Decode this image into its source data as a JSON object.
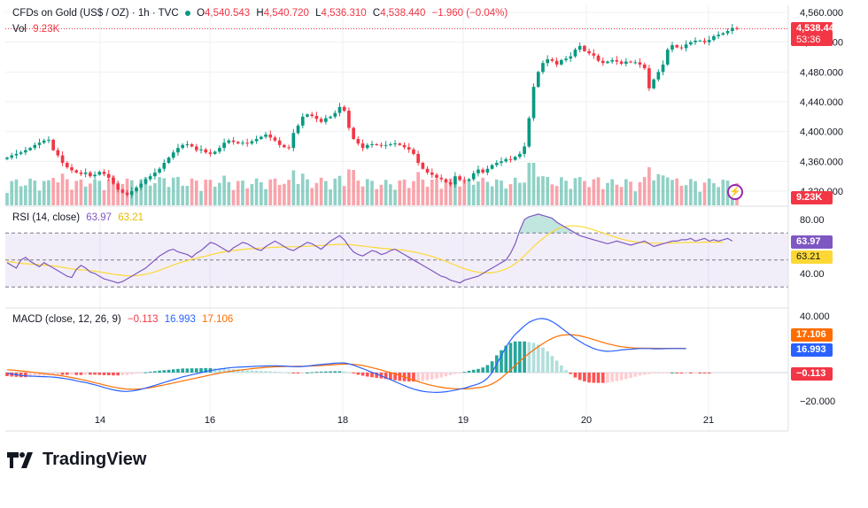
{
  "header": {
    "symbol": "CFDs on Gold (US$ / OZ) · 1h · TVC",
    "open_label": "O",
    "open": "4,540.543",
    "high_label": "H",
    "high": "4,540.720",
    "low_label": "L",
    "low": "4,536.310",
    "close_label": "C",
    "close": "4,538.440",
    "change": "−1.960 (−0.04%)",
    "vol_label": "Vol",
    "vol": "9.23K"
  },
  "price_tag": {
    "value": "4,538.440",
    "countdown": "53:36"
  },
  "vol_tag": "9.23K",
  "rsi_label": {
    "name": "RSI (14, close)",
    "value": "63.97",
    "ma": "63.21"
  },
  "rsi_tags": {
    "value": "63.97",
    "ma": "63.21"
  },
  "macd_label": {
    "name": "MACD (close, 12, 26, 9)",
    "hist": "−0.113",
    "macd": "16.993",
    "signal": "17.106"
  },
  "macd_tags": {
    "signal": "17.106",
    "macd": "16.993",
    "hist": "−0.113"
  },
  "logo_text": "TradingView",
  "colors": {
    "up": "#089981",
    "down": "#f23645",
    "rsi": "#7e57c2",
    "rsi_ma": "#fdd835",
    "macd": "#2962ff",
    "signal": "#ff6d00"
  },
  "chart_data": [
    {
      "type": "candlestick",
      "title": "CFDs on Gold (US$ / OZ)",
      "ylim": [
        4300,
        4560
      ],
      "y_ticks": [
        "4,560.000",
        "4,520.000",
        "4,480.000",
        "4,440.000",
        "4,400.000",
        "4,360.000",
        "4,320.000"
      ],
      "x_ticks": [
        "14",
        "16",
        "18",
        "19",
        "20",
        "21"
      ],
      "close_series": [
        4365,
        4368,
        4370,
        4372,
        4375,
        4378,
        4382,
        4385,
        4388,
        4389,
        4375,
        4368,
        4358,
        4352,
        4348,
        4345,
        4343,
        4345,
        4340,
        4342,
        4346,
        4343,
        4338,
        4330,
        4322,
        4318,
        4315,
        4320,
        4325,
        4330,
        4336,
        4340,
        4345,
        4350,
        4358,
        4365,
        4372,
        4378,
        4382,
        4383,
        4380,
        4375,
        4376,
        4372,
        4370,
        4373,
        4378,
        4385,
        4388,
        4386,
        4384,
        4385,
        4384,
        4387,
        4390,
        4393,
        4396,
        4392,
        4388,
        4382,
        4379,
        4378,
        4398,
        4408,
        4420,
        4423,
        4421,
        4417,
        4413,
        4418,
        4420,
        4425,
        4433,
        4428,
        4405,
        4390,
        4384,
        4378,
        4382,
        4383,
        4382,
        4381,
        4382,
        4383,
        4384,
        4382,
        4379,
        4376,
        4370,
        4358,
        4350,
        4345,
        4342,
        4338,
        4336,
        4332,
        4329,
        4340,
        4335,
        4334,
        4336,
        4344,
        4349,
        4345,
        4350,
        4355,
        4358,
        4360,
        4363,
        4362,
        4366,
        4370,
        4380,
        4418,
        4460,
        4480,
        4492,
        4497,
        4495,
        4490,
        4496,
        4498,
        4501,
        4510,
        4515,
        4508,
        4505,
        4502,
        4495,
        4492,
        4494,
        4496,
        4494,
        4491,
        4494,
        4493,
        4493,
        4490,
        4485,
        4458,
        4470,
        4480,
        4490,
        4510,
        4516,
        4513,
        4512,
        4517,
        4520,
        4522,
        4522,
        4520,
        4523,
        4528,
        4530,
        4532,
        4535,
        4539,
        4538
      ],
      "volume_title": "Vol",
      "volume_last": "9.23K"
    },
    {
      "type": "line",
      "title": "RSI (14, close)",
      "ylim": [
        20,
        100
      ],
      "y_ticks": [
        "80.00",
        "40.00"
      ],
      "bands": [
        70,
        50,
        30
      ],
      "series": [
        {
          "name": "RSI",
          "values": [
            48,
            46,
            44,
            50,
            52,
            49,
            47,
            45,
            48,
            46,
            44,
            42,
            40,
            38,
            37,
            43,
            46,
            44,
            41,
            40,
            38,
            36,
            35,
            34,
            33,
            34,
            36,
            38,
            40,
            42,
            44,
            47,
            50,
            53,
            55,
            57,
            58,
            56,
            55,
            54,
            52,
            55,
            57,
            60,
            63,
            62,
            60,
            58,
            56,
            59,
            61,
            63,
            62,
            60,
            58,
            57,
            60,
            62,
            64,
            62,
            60,
            58,
            57,
            59,
            61,
            63,
            62,
            60,
            58,
            61,
            64,
            66,
            68,
            65,
            60,
            56,
            54,
            53,
            55,
            57,
            56,
            54,
            55,
            57,
            58,
            56,
            54,
            52,
            50,
            48,
            46,
            44,
            42,
            40,
            38,
            37,
            35,
            34,
            33,
            35,
            36,
            37,
            38,
            40,
            42,
            44,
            46,
            48,
            50,
            55,
            62,
            72,
            80,
            82,
            83,
            84,
            83,
            82,
            81,
            78,
            76,
            74,
            72,
            70,
            68,
            67,
            66,
            65,
            64,
            63,
            62,
            63,
            64,
            63,
            62,
            61,
            62,
            63,
            64,
            62,
            60,
            61,
            62,
            63,
            64,
            64,
            65,
            65,
            66,
            64,
            65,
            66,
            64,
            65,
            64,
            65,
            66,
            64
          ]
        },
        {
          "name": "RSI-MA",
          "values": [
            49,
            48.5,
            48,
            47.5,
            47.2,
            47,
            46.8,
            46.5,
            46.2,
            46,
            45.6,
            45.2,
            44.6,
            44,
            43.4,
            43,
            42.7,
            42.4,
            42.1,
            41.7,
            41.2,
            40.6,
            40,
            39.5,
            39,
            38.6,
            38.3,
            38.2,
            38.4,
            38.8,
            39.4,
            40.2,
            41.2,
            42.4,
            43.7,
            45,
            46.3,
            47.5,
            48.6,
            49.6,
            50.5,
            51.3,
            52.1,
            52.9,
            53.8,
            54.6,
            55.4,
            56,
            56.5,
            57,
            57.4,
            57.8,
            58.1,
            58.4,
            58.6,
            58.8,
            59,
            59.2,
            59.4,
            59.6,
            59.7,
            59.8,
            59.8,
            59.9,
            60,
            60.2,
            60.4,
            60.6,
            60.8,
            61,
            61.2,
            61.4,
            61.6,
            61.6,
            61.4,
            61.1,
            60.7,
            60.3,
            59.9,
            59.5,
            59.1,
            58.7,
            58.4,
            58.1,
            57.8,
            57.5,
            57.1,
            56.6,
            56,
            55.3,
            54.5,
            53.6,
            52.6,
            51.5,
            50.3,
            49,
            47.6,
            46.2,
            44.8,
            43.6,
            42.5,
            41.6,
            40.9,
            40.5,
            40.4,
            40.6,
            41.2,
            42.1,
            43.3,
            45,
            47.2,
            50,
            53.2,
            56.6,
            60,
            63.1,
            66,
            68.6,
            70.9,
            72.7,
            74,
            74.9,
            75.3,
            75.3,
            74.9,
            74.2,
            73.3,
            72.3,
            71.2,
            70,
            68.8,
            67.7,
            66.6,
            65.6,
            64.7,
            64,
            63.4,
            63,
            62.7,
            62.5,
            62.4,
            62.4,
            62.4,
            62.5,
            62.6,
            62.7,
            62.8,
            62.9,
            63,
            63.1,
            63.1,
            63.2,
            63.2,
            63.2,
            63.2,
            63.21
          ]
        }
      ]
    },
    {
      "type": "line",
      "title": "MACD (close, 12, 26, 9)",
      "ylim": [
        -25,
        45
      ],
      "y_ticks": [
        "40.000",
        "-20.000"
      ],
      "series": [
        {
          "name": "MACD",
          "values": [
            -0.5,
            -1,
            -1.5,
            -2,
            -2.3,
            -2.5,
            -2.6,
            -2.8,
            -2.9,
            -3,
            -3.2,
            -3.5,
            -4,
            -4.5,
            -5,
            -5.8,
            -6.5,
            -7,
            -7.8,
            -8.6,
            -9.5,
            -10.5,
            -11.4,
            -12.2,
            -12.8,
            -13.2,
            -13.3,
            -13,
            -12.5,
            -11.8,
            -10.9,
            -10,
            -9,
            -8,
            -7,
            -6,
            -5,
            -4,
            -3,
            -2.3,
            -1.5,
            -0.8,
            0,
            0.8,
            1.5,
            2,
            2.5,
            2.9,
            3.3,
            3.6,
            3.8,
            4,
            4.1,
            4.3,
            4.5,
            4.6,
            4.7,
            4.8,
            4.8,
            4.7,
            4.6,
            4.4,
            4.2,
            4.1,
            4.3,
            4.6,
            5,
            5.4,
            5.7,
            6,
            6.3,
            6.6,
            6.8,
            6.8,
            6.2,
            5.2,
            4,
            2.8,
            1.5,
            0.2,
            -1,
            -2.3,
            -3.6,
            -5,
            -6.4,
            -7.8,
            -9.2,
            -10.5,
            -11.6,
            -12.5,
            -13.2,
            -13.6,
            -13.9,
            -14,
            -13.8,
            -13.5,
            -13,
            -12.4,
            -11.7,
            -11,
            -10,
            -9,
            -8,
            -6.5,
            -4,
            0,
            6,
            12,
            18,
            23,
            27,
            30,
            33,
            35.5,
            37,
            38,
            38.2,
            37.5,
            36,
            34,
            31.5,
            29,
            26.5,
            24,
            22,
            20,
            18.5,
            17,
            16,
            15.3,
            15,
            15.2,
            15.5,
            16,
            16.3,
            16.5,
            16.8,
            17,
            17,
            17,
            16.8,
            16.8,
            16.9,
            17,
            17,
            17,
            16.99,
            16.993
          ]
        },
        {
          "name": "Signal",
          "values": [
            2,
            1.8,
            1.5,
            1.2,
            0.9,
            0.5,
            0.1,
            -0.3,
            -0.7,
            -1.1,
            -1.5,
            -1.9,
            -2.4,
            -2.9,
            -3.5,
            -4.1,
            -4.8,
            -5.5,
            -6.3,
            -7.1,
            -7.9,
            -8.7,
            -9.5,
            -10.2,
            -10.8,
            -11.3,
            -11.6,
            -11.8,
            -11.7,
            -11.5,
            -11.1,
            -10.6,
            -10,
            -9.4,
            -8.7,
            -8,
            -7.3,
            -6.6,
            -5.9,
            -5.2,
            -4.5,
            -3.8,
            -3.1,
            -2.4,
            -1.7,
            -1,
            -0.4,
            0.2,
            0.7,
            1.2,
            1.6,
            2,
            2.4,
            2.8,
            3.1,
            3.4,
            3.7,
            3.9,
            4.1,
            4.2,
            4.3,
            4.4,
            4.4,
            4.5,
            4.5,
            4.6,
            4.7,
            4.8,
            5,
            5.2,
            5.4,
            5.6,
            5.8,
            6,
            6,
            5.8,
            5.5,
            5,
            4.3,
            3.5,
            2.7,
            1.8,
            0.9,
            0,
            -1,
            -2,
            -3.1,
            -4.2,
            -5.3,
            -6.4,
            -7.4,
            -8.3,
            -9.1,
            -9.8,
            -10.4,
            -10.9,
            -11.2,
            -11.4,
            -11.5,
            -11.5,
            -11.3,
            -11,
            -10.6,
            -10.1,
            -9.3,
            -8,
            -6.2,
            -3.8,
            -1,
            2,
            5,
            8,
            11,
            13.5,
            16,
            18.3,
            20.5,
            22.5,
            24.2,
            25.5,
            26.3,
            26.7,
            26.8,
            26.5,
            26,
            25.2,
            24.3,
            23.3,
            22.3,
            21.3,
            20.4,
            19.6,
            18.9,
            18.3,
            17.9,
            17.6,
            17.4,
            17.3,
            17.2,
            17.2,
            17.2,
            17.15,
            17.1,
            17.1,
            17.1,
            17.1,
            17.1,
            17.106
          ]
        },
        {
          "name": "Histogram",
          "values": [
            -2.5,
            -2.8,
            -3,
            -3.2,
            -3.2,
            -3,
            -2.7,
            -2.5,
            -2.2,
            -1.9,
            -1.7,
            -1.6,
            -1.6,
            -1.6,
            -1.5,
            -1.7,
            -1.7,
            -1.5,
            -1.5,
            -1.5,
            -1.6,
            -1.8,
            -1.9,
            -2,
            -2,
            -1.9,
            -1.7,
            -1.2,
            -0.8,
            -0.3,
            0.2,
            0.6,
            1,
            1.4,
            1.7,
            2,
            2.3,
            2.6,
            2.9,
            2.9,
            3,
            3,
            3.1,
            3.2,
            3.2,
            3,
            2.9,
            2.7,
            2.6,
            2.4,
            2.2,
            2,
            1.7,
            1.5,
            1.4,
            1.2,
            1,
            0.9,
            0.7,
            0.5,
            0.3,
            0,
            -0.2,
            -0.4,
            -0.2,
            0,
            0.3,
            0.6,
            0.7,
            0.8,
            0.9,
            1,
            1,
            0.8,
            0.2,
            -0.6,
            -1.5,
            -2.2,
            -2.8,
            -3.3,
            -3.7,
            -4.1,
            -4.5,
            -5,
            -5.4,
            -5.8,
            -6.1,
            -6.3,
            -6.3,
            -6.1,
            -5.8,
            -5.3,
            -4.8,
            -4.2,
            -3.4,
            -2.6,
            -1.8,
            -1,
            -0.2,
            0.5,
            1.3,
            2,
            2.6,
            3.6,
            5.3,
            8,
            12.2,
            15.8,
            19,
            21,
            22,
            22,
            22,
            21.5,
            21,
            19.7,
            17.7,
            15,
            11.8,
            8.5,
            5,
            1.8,
            -1,
            -3.5,
            -5.2,
            -6.2,
            -7,
            -7.2,
            -7.3,
            -7.3,
            -7.1,
            -6.6,
            -6,
            -5.4,
            -4.6,
            -3.8,
            -2.9,
            -2.1,
            -1.4,
            -1.1,
            -0.7,
            -0.4,
            -0.2,
            -0.1,
            0,
            -0.2,
            -0.3,
            -0.2,
            -0.2,
            -0.1,
            -0.1,
            -0.1,
            -0.113
          ]
        }
      ]
    }
  ]
}
